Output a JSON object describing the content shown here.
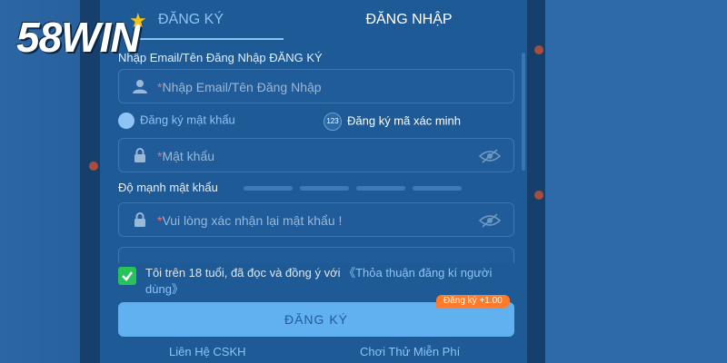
{
  "logo": {
    "text": "58WIN"
  },
  "tabs": [
    {
      "label": "ĐĂNG KÝ",
      "active": true
    },
    {
      "label": "ĐĂNG NHẬP",
      "active": false
    }
  ],
  "form": {
    "account_label": "Nhập Email/Tên Đăng Nhập ĐĂNG KÝ",
    "account_placeholder": "Nhập Email/Tên Đăng Nhập",
    "required_mark": "*",
    "option_password": "Đăng ký mật khẩu",
    "option_code": "Đăng ký mã xác minh",
    "option_code_icon": "123",
    "password_placeholder": "Mật khẩu",
    "strength_label": "Độ mạnh mật khẩu",
    "confirm_placeholder": "Vui lòng xác nhận lại mật khẩu !",
    "terms_text": "Tôi trên 18 tuổi, đã đọc và đồng ý với",
    "terms_link": "《Thỏa thuận đăng kí người dùng》",
    "terms_checked": true,
    "submit_label": "ĐĂNG KÝ",
    "badge": "Đăng ký +1.00"
  },
  "footer": {
    "support": "Liên Hệ CSKH",
    "trial": "Chơi Thử Miễn Phí"
  },
  "colors": {
    "accent": "#8ec3f5",
    "panel": "#1e5a96",
    "button": "#61b0f0",
    "badge": "#ff7a2a",
    "check": "#27c25a"
  }
}
